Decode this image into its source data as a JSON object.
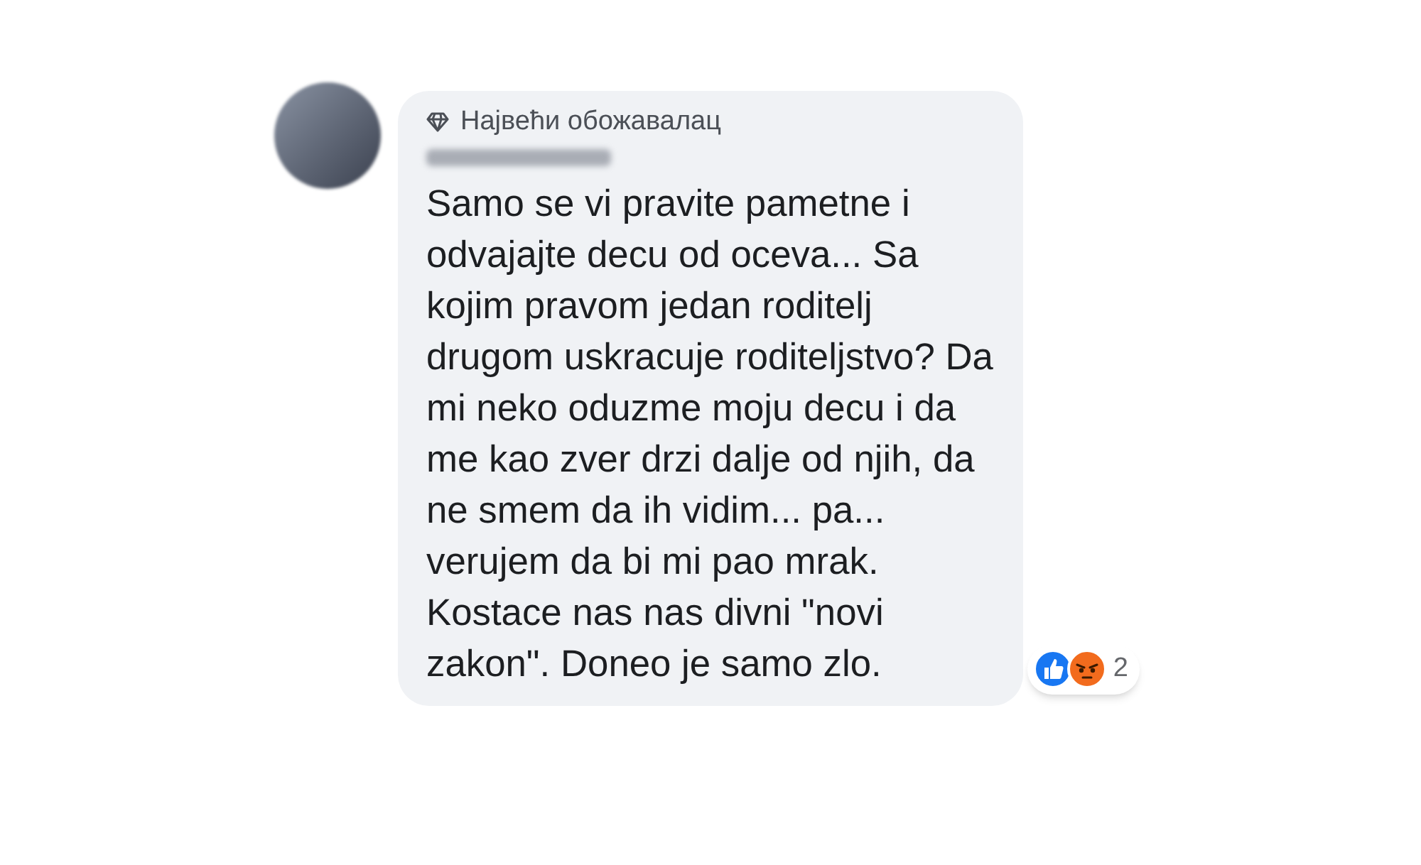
{
  "comment": {
    "badge": "Највећи обожавалац",
    "paragraphs": [
      "Samo se vi pravite pametne i odvajajte decu od oceva... Sa kojim pravom jedan roditelj drugom uskracuje roditeljstvo? Da mi neko oduzme moju decu i da me kao zver drzi dalje od njih, da ne smem da ih vidim... pa... verujem da bi mi pao mrak.",
      "Kostace nas nas divni \"novi zakon\". Doneo je samo zlo."
    ],
    "reactions": {
      "icons": [
        {
          "kind": "like"
        },
        {
          "kind": "angry"
        }
      ],
      "count": "2"
    }
  }
}
